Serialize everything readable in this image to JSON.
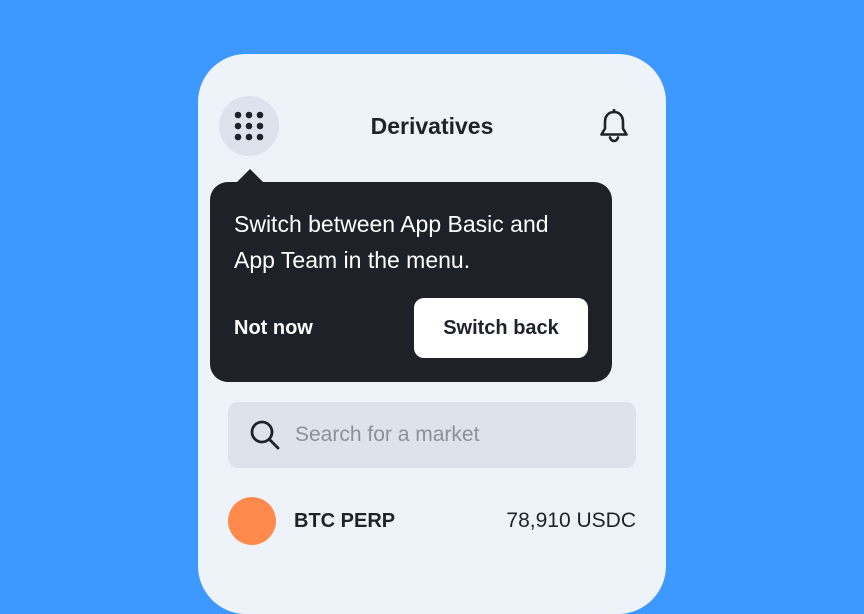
{
  "header": {
    "title": "Derivatives",
    "menu_icon": "grid-icon",
    "notification_icon": "bell-icon"
  },
  "tooltip": {
    "message": "Switch between App Basic and App Team in the menu.",
    "dismiss_label": "Not now",
    "confirm_label": "Switch back"
  },
  "search": {
    "placeholder": "Search for a market",
    "value": "",
    "icon": "search-icon"
  },
  "markets": [
    {
      "name": "BTC PERP",
      "price": "78,910 USDC",
      "icon_color": "#FF8A4C"
    }
  ],
  "colors": {
    "background": "#3D98FF",
    "panel": "#EEF3FA",
    "tooltip": "#1F2128",
    "text": "#1E2229"
  }
}
